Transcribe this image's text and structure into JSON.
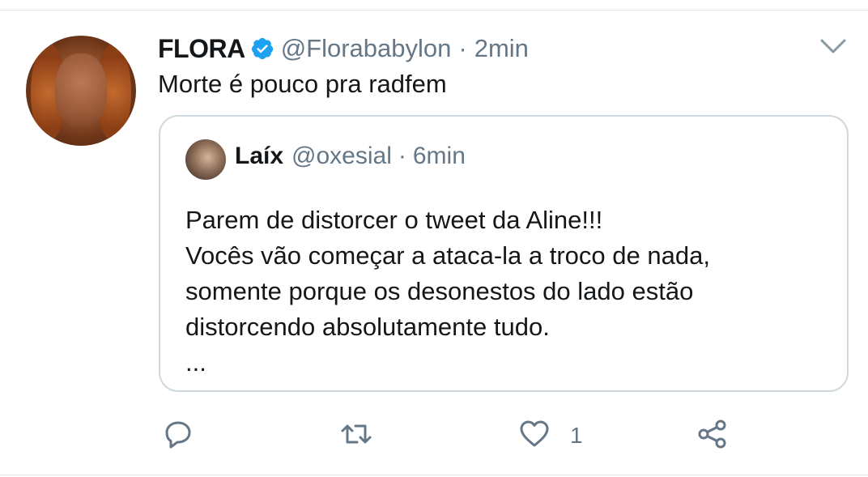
{
  "tweet": {
    "display_name": "FLORA",
    "handle": "@Florababylon",
    "separator": "·",
    "time": "2min",
    "text": "Morte é pouco pra radfem"
  },
  "quoted_tweet": {
    "display_name": "Laíx",
    "handle": "@oxesial",
    "separator": "·",
    "time": "6min",
    "lines": [
      "Parem de distorcer o tweet da Aline!!!",
      "Vocês vão começar a ataca-la a troco de nada,",
      "somente porque os desonestos do lado estão",
      "distorcendo absolutamente tudo.",
      "..."
    ]
  },
  "actions": {
    "reply_icon": "reply-icon",
    "retweet_icon": "retweet-icon",
    "like_icon": "heart-icon",
    "like_count": "1",
    "share_icon": "share-icon"
  },
  "colors": {
    "text": "#14171a",
    "secondary": "#657786",
    "verified_blue": "#1da1f2",
    "border": "#cfd9de"
  }
}
